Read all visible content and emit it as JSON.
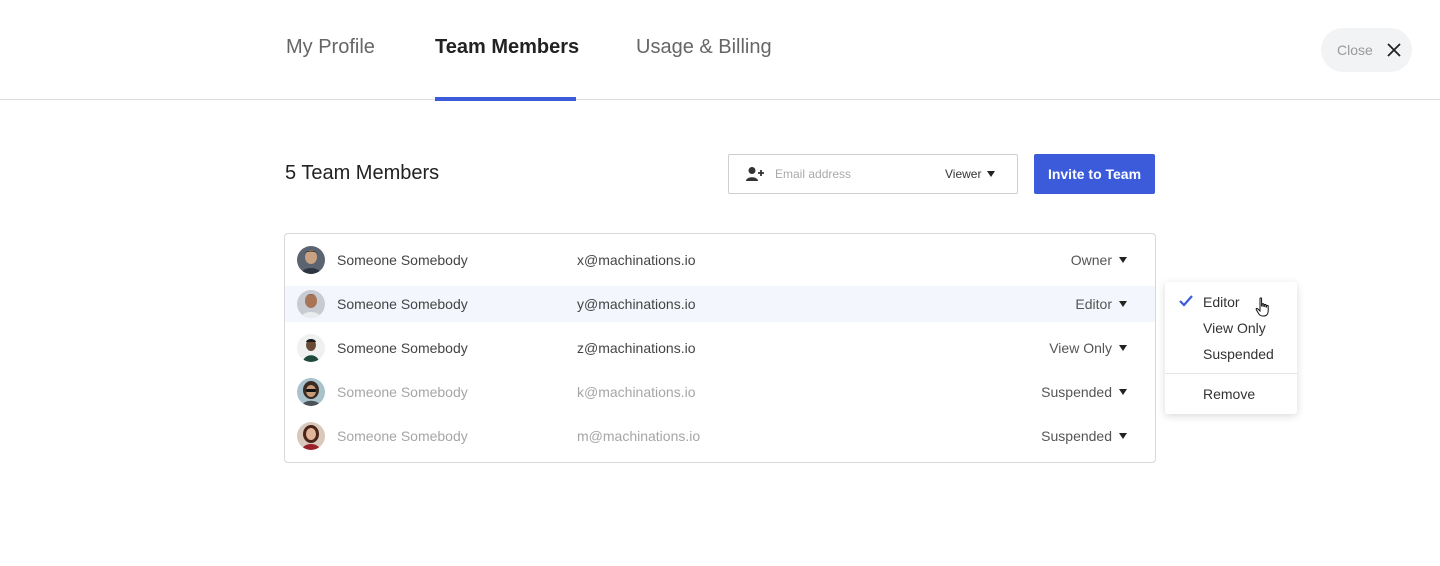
{
  "tabs": [
    {
      "label": "My Profile"
    },
    {
      "label": "Team Members"
    },
    {
      "label": "Usage & Billing"
    }
  ],
  "close": {
    "label": "Close",
    "icon": "close-icon"
  },
  "heading": "5 Team Members",
  "invite": {
    "placeholder": "Email address",
    "value": "",
    "role": "Viewer",
    "button_label": "Invite to Team",
    "icon": "user-plus-icon"
  },
  "members": [
    {
      "name": "Someone Somebody",
      "email": "x@machinations.io",
      "role": "Owner"
    },
    {
      "name": "Someone Somebody",
      "email": "y@machinations.io",
      "role": "Editor"
    },
    {
      "name": "Someone Somebody",
      "email": "z@machinations.io",
      "role": "View Only"
    },
    {
      "name": "Someone Somebody",
      "email": "k@machinations.io",
      "role": "Suspended"
    },
    {
      "name": "Someone Somebody",
      "email": "m@machinations.io",
      "role": "Suspended"
    }
  ],
  "role_menu": {
    "items": [
      {
        "label": "Editor",
        "selected": true
      },
      {
        "label": "View Only",
        "selected": false
      },
      {
        "label": "Suspended",
        "selected": false
      }
    ],
    "remove_label": "Remove"
  },
  "colors": {
    "accent": "#3b5bdb",
    "highlight_row": "#f3f6fc",
    "muted_text": "#a6a6a6"
  }
}
